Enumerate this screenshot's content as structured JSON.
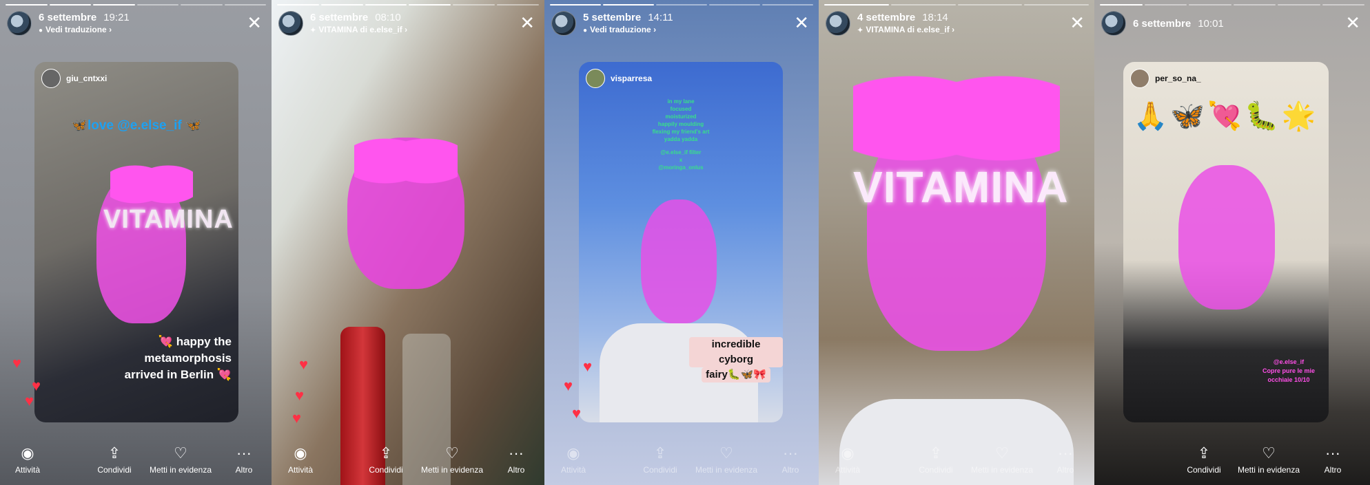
{
  "colors": {
    "accent_pink": "#ff4fe8",
    "heart_red": "#ff3045",
    "mention_blue": "#1da1f2"
  },
  "panels": [
    {
      "date": "6 settembre",
      "time": "19:21",
      "subtitle": "Vedi traduzione ›",
      "subtitle_icon": "translate-bubble-icon",
      "card_user": "giu_cntxxi",
      "top_text": "🦋love @e.else_if 🦋",
      "filter_word": "VITAMINA",
      "caption": "💘 happy the metamorphosis arrived in Berlin 💘",
      "buttons": [
        "Attività",
        "Condividi",
        "Metti in evidenza",
        "Altro"
      ]
    },
    {
      "date": "6 settembre",
      "time": "08:10",
      "subtitle": "VITAMINA di e.else_if ›",
      "subtitle_icon": "effect-sparkle-icon",
      "buttons": [
        "Attività",
        "Condividi",
        "Metti in evidenza",
        "Altro"
      ]
    },
    {
      "date": "5 settembre",
      "time": "14:11",
      "subtitle": "Vedi traduzione ›",
      "subtitle_icon": "translate-bubble-icon",
      "card_user": "visparresa",
      "poem": [
        "in my lane",
        "focused",
        "moisturized",
        "happily moulding",
        "flexing my friend's art",
        "yadda yadda",
        "",
        "@e.else_if filter",
        "x",
        "@moringa_onlus"
      ],
      "caption_lines": [
        "incredible cyborg",
        "fairy🐛🦋🎀"
      ],
      "buttons": [
        "Attività",
        "Condividi",
        "Metti in evidenza",
        "Altro"
      ]
    },
    {
      "date": "4 settembre",
      "time": "18:14",
      "subtitle": "VITAMINA di e.else_if ›",
      "subtitle_icon": "effect-sparkle-icon",
      "filter_word": "VITAMINA",
      "buttons": [
        "Attività",
        "Condividi",
        "Metti in evidenza",
        "Altro"
      ]
    },
    {
      "date": "6 settembre",
      "time": "10:01",
      "card_user": "per_so_na_",
      "emoji_row": "🙏🦋💘🐛🌟",
      "caption_lines": [
        "@e.else_if",
        "Copre pure le mie",
        "occhiaie 10/10"
      ],
      "buttons": [
        "Condividi",
        "Metti in evidenza",
        "Altro"
      ]
    }
  ]
}
